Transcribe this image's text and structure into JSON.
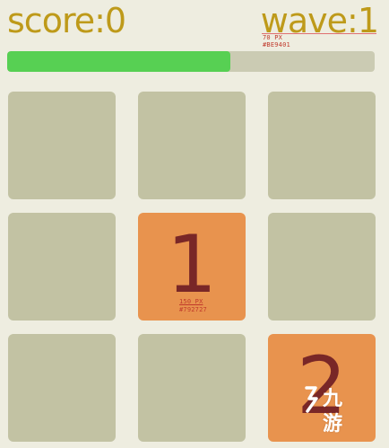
{
  "header": {
    "score_label": "score:0",
    "wave_label": "wave:1",
    "annotation_size": "70 PX",
    "annotation_color": "#BE9401"
  },
  "progress": {
    "fraction": 0.607,
    "fill_color": "#57d053",
    "track_color": "#cbcbb3"
  },
  "board": {
    "rows": 3,
    "cols": 3,
    "cells": [
      {
        "value": ""
      },
      {
        "value": ""
      },
      {
        "value": ""
      },
      {
        "value": ""
      },
      {
        "value": "1"
      },
      {
        "value": ""
      },
      {
        "value": ""
      },
      {
        "value": ""
      },
      {
        "value": "2"
      }
    ],
    "empty_color": "#c2c2a3",
    "tile_color": "#e8934e",
    "number_color": "#792727"
  },
  "tile_annotation": {
    "size": "150 PX",
    "color": "#792727"
  },
  "watermark": {
    "text": "九游",
    "icon": "jiuyou-logo-icon"
  }
}
